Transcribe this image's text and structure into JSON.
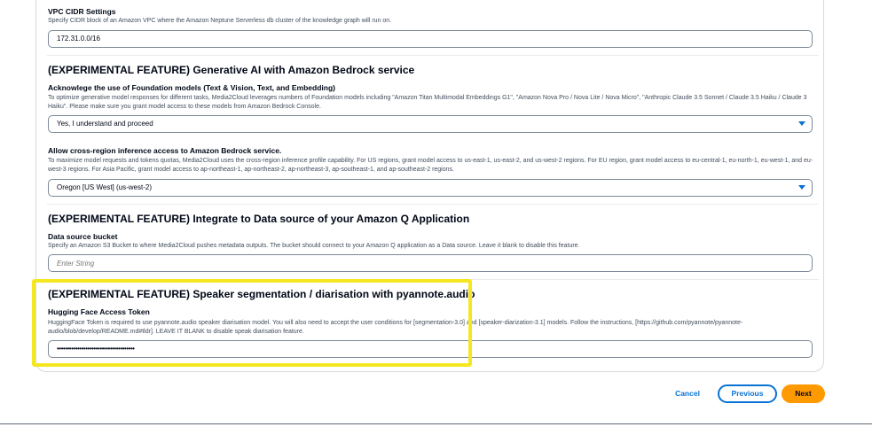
{
  "vpc": {
    "label": "VPC CIDR Settings",
    "description": "Specify CIDR block of an Amazon VPC where the Amazon Neptune Serverless db cluster of the knowledge graph will run on.",
    "value": "172.31.0.0/16"
  },
  "bedrock": {
    "title": "(EXPERIMENTAL FEATURE) Generative AI with Amazon Bedrock service",
    "foundation": {
      "label": "Acknowlege the use of Foundation models (Text & Vision, Text, and Embedding)",
      "description": "To optimize generative model responses for different tasks, Media2Cloud leverages numbers of Foundation models including \"Amazon Titan Multimodal Embeddings G1\", \"Amazon Nova Pro / Nova Lite / Nova Micro\", \"Anthropic Claude 3.5 Sonnet / Claude 3.5 Haiku / Claude 3 Haiku\". Please make sure you grant model access to these models from Amazon Bedrock Console.",
      "selected": "Yes, I understand and proceed"
    },
    "crossregion": {
      "label": "Allow cross-region inference access to Amazon Bedrock service.",
      "description": "To maximize model requests and tokens quotas, Media2Cloud uses the cross-region inference profile capability. For US regions, grant model access to us-east-1, us-east-2, and us-west-2 regions. For EU region, grant model access to eu-central-1, eu-north-1, eu-west-1, and eu-west-3 regions. For Asia Pacific, grant model access to ap-northeast-1, ap-northeast-2, ap-northeast-3, ap-southeast-1, and ap-southeast-2 regions.",
      "selected": "Oregon [US West] (us-west-2)"
    }
  },
  "amazonq": {
    "title": "(EXPERIMENTAL FEATURE) Integrate to Data source of your Amazon Q Application",
    "label": "Data source bucket",
    "description": "Specify an Amazon S3 Bucket to where Media2Cloud pushes metadata outputs. The bucket should connect to your Amazon Q application as a Data source. Leave it blank to disable this feature.",
    "placeholder": "Enter String"
  },
  "speaker": {
    "title": "(EXPERIMENTAL FEATURE) Speaker segmentation / diarisation with pyannote.audio",
    "label": "Hugging Face Access Token",
    "description": "HuggingFace Token is required to use pyannote.audio speaker diarisation model. You will also need to accept the user conditions for [segmentation-3.0] and [speaker-diarization-3.1] models. Follow the instructions, [https://github.com/pyannote/pyannote-audio/blob/develop/README.md#tldr]. LEAVE IT BLANK to disable speak diarisation feature.",
    "value": "••••••••••••••••••••••••••••••••••••••"
  },
  "actions": {
    "cancel": "Cancel",
    "previous": "Previous",
    "next": "Next"
  },
  "colors": {
    "highlight": "#f5e71f",
    "primary": "#ff9900",
    "link": "#0972d3"
  }
}
